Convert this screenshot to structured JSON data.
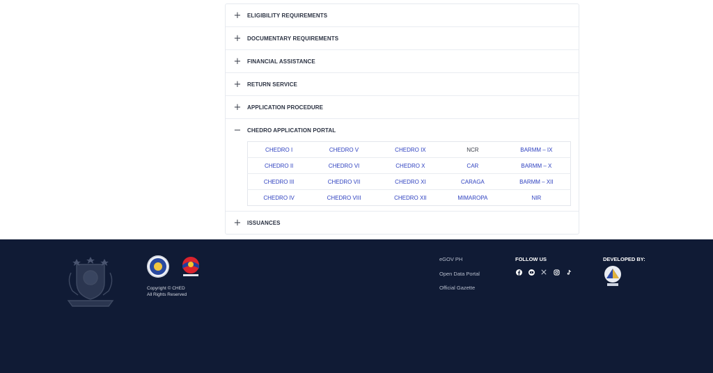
{
  "accordion": {
    "items": [
      {
        "label": "ELIGIBILITY REQUIREMENTS",
        "icon": "+"
      },
      {
        "label": "DOCUMENTARY REQUIREMENTS",
        "icon": "+"
      },
      {
        "label": "FINANCIAL ASSISTANCE",
        "icon": "+"
      },
      {
        "label": "RETURN SERVICE",
        "icon": "+"
      },
      {
        "label": "APPLICATION PROCEDURE",
        "icon": "+"
      },
      {
        "label": "CHEDRO APPLICATION PORTAL",
        "icon": "−"
      },
      {
        "label": "ISSUANCES",
        "icon": "+"
      }
    ]
  },
  "portal": {
    "rows": [
      [
        "CHEDRO I",
        "CHEDRO V",
        "CHEDRO IX",
        "NCR",
        "BARMM – IX"
      ],
      [
        "CHEDRO II",
        "CHEDRO VI",
        "CHEDRO X",
        "CAR",
        "BARMM – X"
      ],
      [
        "CHEDRO III",
        "CHEDRO VII",
        "CHEDRO XI",
        "CARAGA",
        "BARMM – XII"
      ],
      [
        "CHEDRO IV",
        "CHEDRO VIII",
        "CHEDRO XII",
        "MIMAROPA",
        "NIR"
      ]
    ],
    "link_color": "#2c3fbf"
  },
  "footer": {
    "copyright_line1": "Copyright © CHED",
    "copyright_line2": "All Rights Reserved",
    "links": [
      "eGOV PH",
      "Open Data Portal",
      "Official Gazette"
    ],
    "follow_title": "FOLLOW US",
    "social_icons": [
      "facebook-icon",
      "youtube-icon",
      "x-icon",
      "instagram-icon",
      "tiktok-icon"
    ],
    "developed_title": "DEVELOPED BY:",
    "background": "#101b35"
  }
}
